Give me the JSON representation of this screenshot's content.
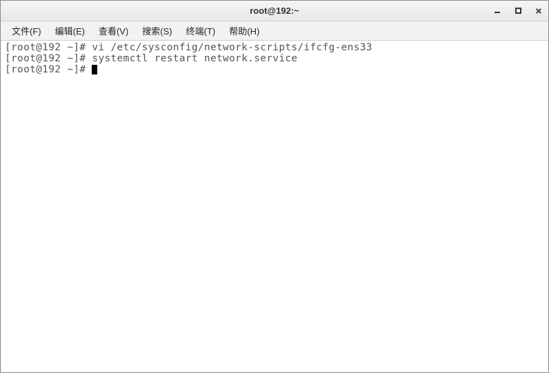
{
  "window": {
    "title": "root@192:~"
  },
  "menubar": {
    "items": [
      {
        "label": "文件(F)"
      },
      {
        "label": "编辑(E)"
      },
      {
        "label": "查看(V)"
      },
      {
        "label": "搜索(S)"
      },
      {
        "label": "终端(T)"
      },
      {
        "label": "帮助(H)"
      }
    ]
  },
  "terminal": {
    "lines": [
      {
        "prompt": "[root@192 ~]# ",
        "cmd": "vi /etc/sysconfig/network-scripts/ifcfg-ens33"
      },
      {
        "prompt": "[root@192 ~]# ",
        "cmd": "systemctl restart network.service"
      },
      {
        "prompt": "[root@192 ~]# ",
        "cmd": ""
      }
    ]
  }
}
